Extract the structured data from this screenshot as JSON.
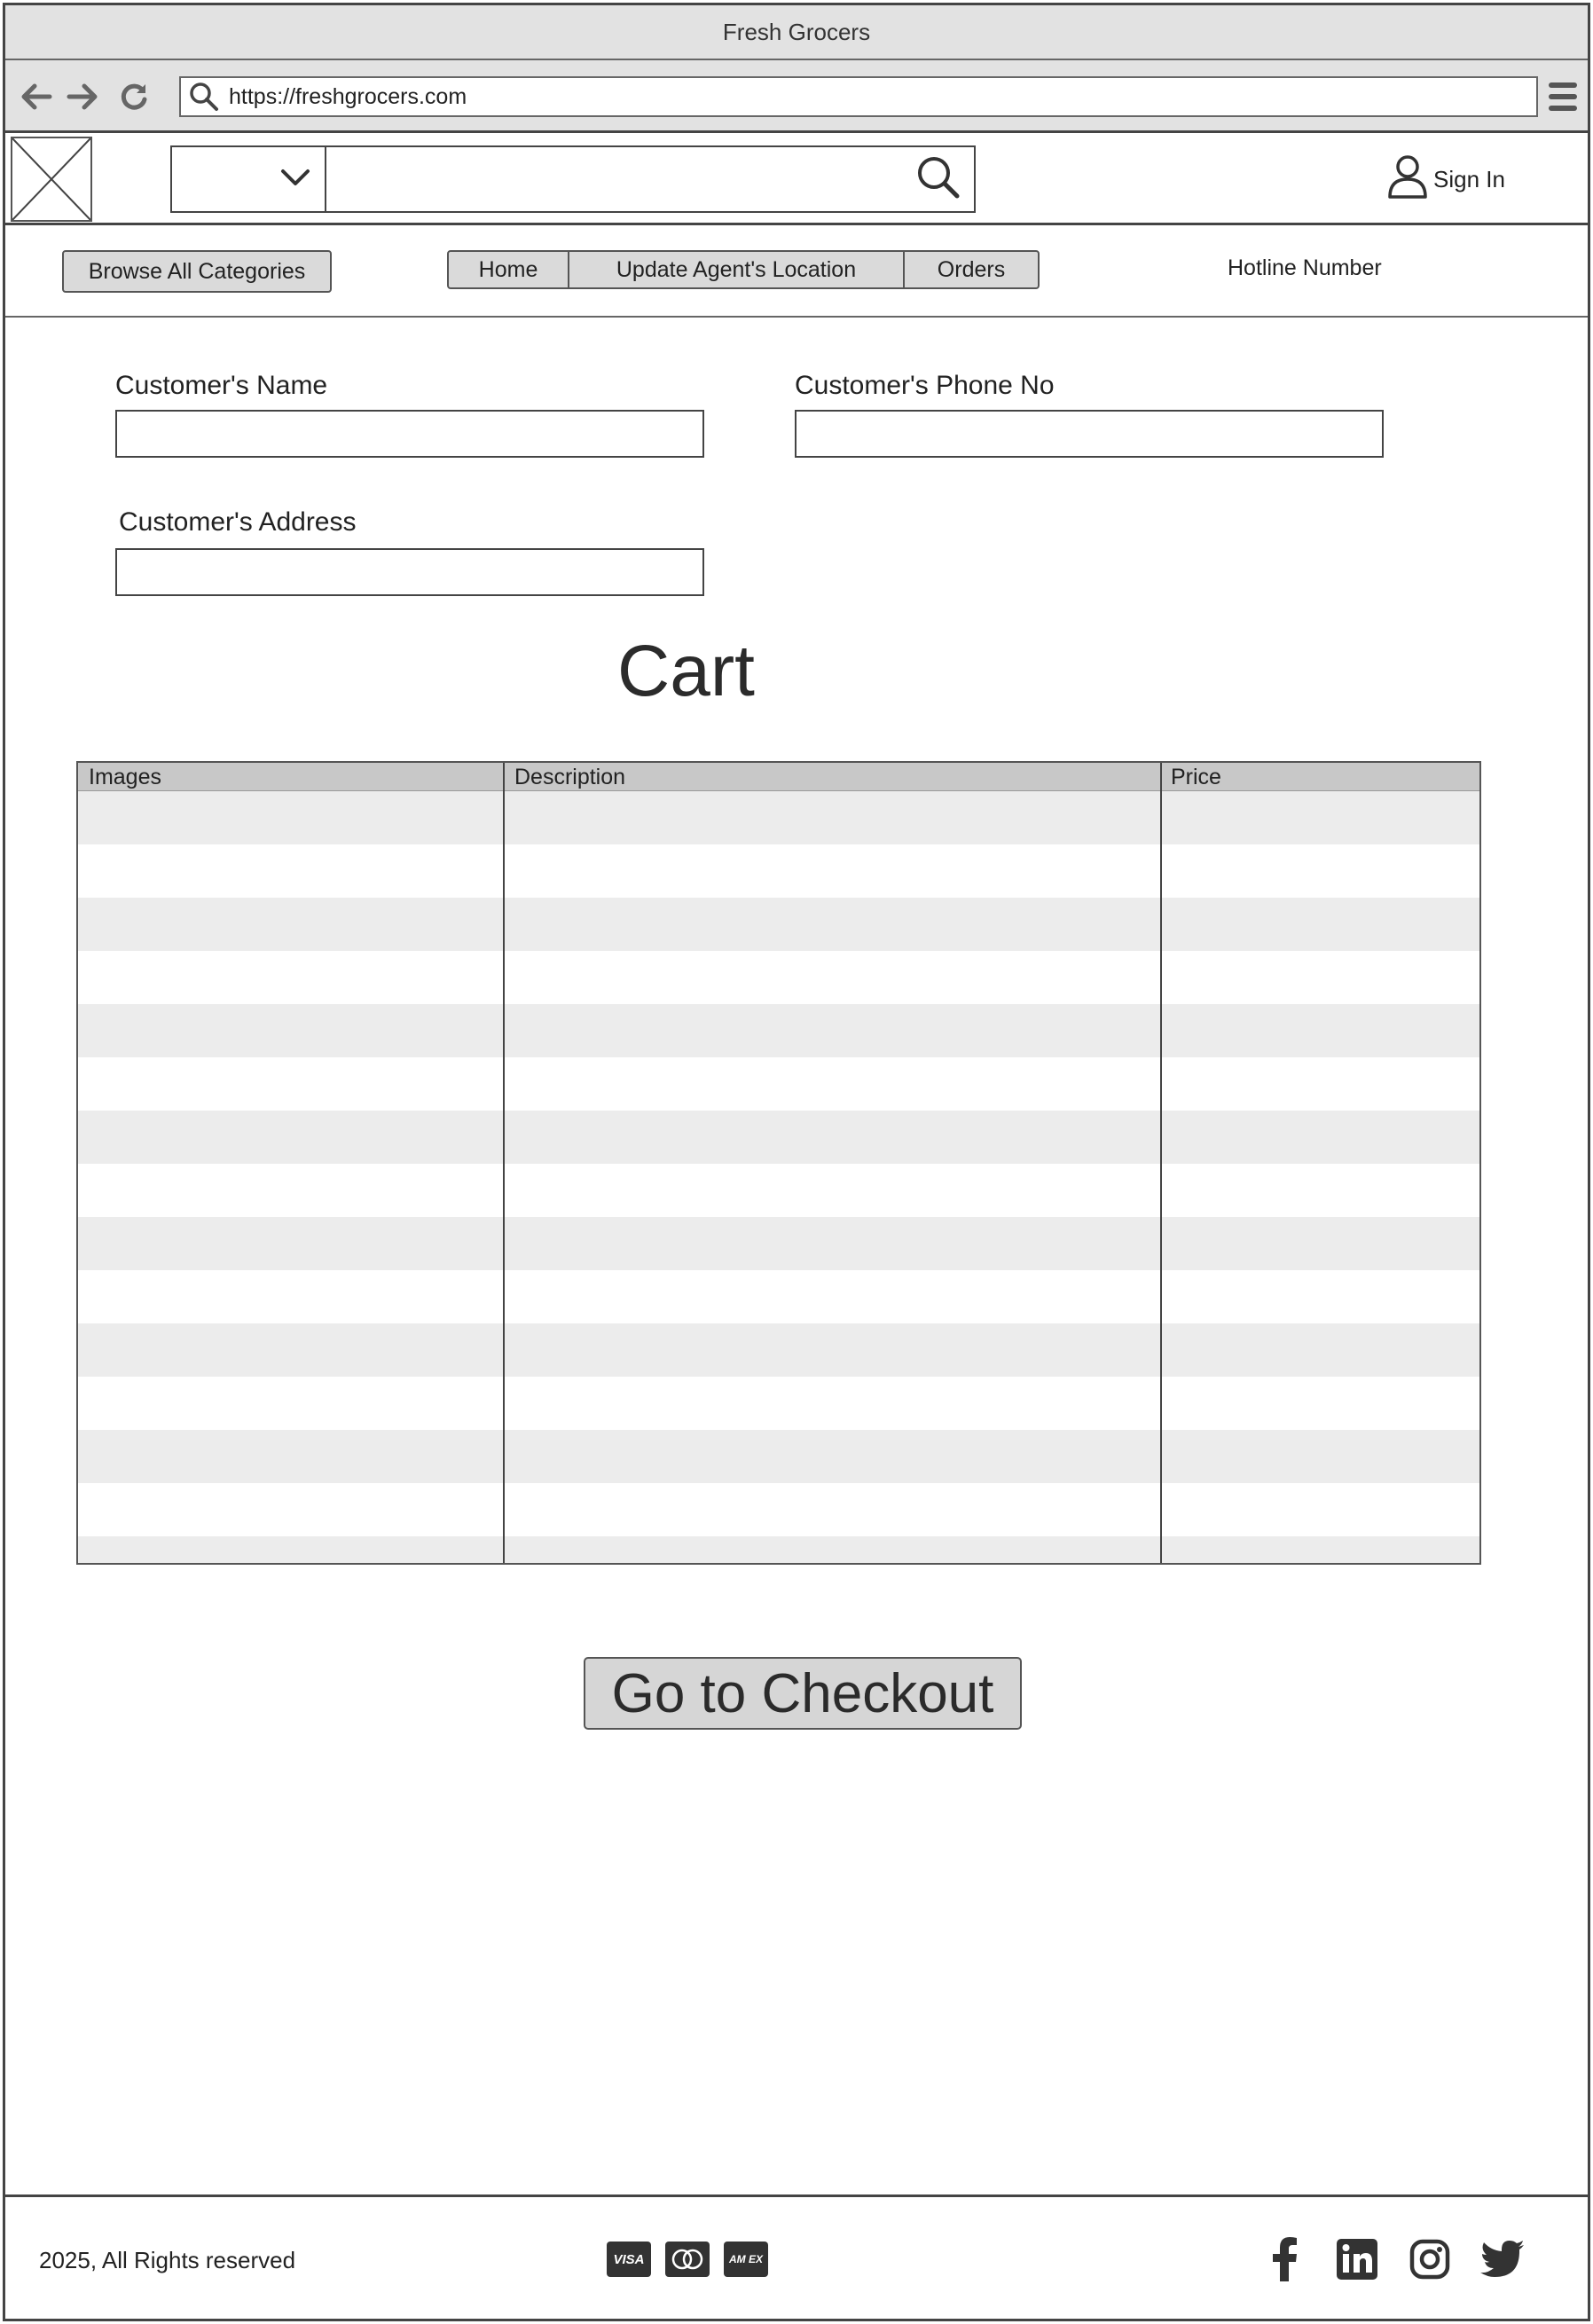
{
  "window": {
    "title": "Fresh Grocers"
  },
  "browser": {
    "url": "https://freshgrocers.com"
  },
  "header": {
    "search_category": "",
    "search_value": "",
    "signin_label": "Sign In"
  },
  "navbar": {
    "browse_label": "Browse All Categories",
    "tabs": [
      {
        "label": "Home"
      },
      {
        "label": "Update Agent's Location"
      },
      {
        "label": "Orders"
      }
    ],
    "hotline_label": "Hotline Number"
  },
  "form": {
    "name_label": "Customer's Name",
    "name_value": "",
    "phone_label": "Customer's Phone No",
    "phone_value": "",
    "address_label": "Customer's Address",
    "address_value": ""
  },
  "cart": {
    "title": "Cart",
    "columns": [
      "Images",
      "Description",
      "Price"
    ],
    "rows": []
  },
  "checkout": {
    "label": "Go to Checkout"
  },
  "footer": {
    "copyright": "2025, All Rights reserved",
    "payments": [
      {
        "icon": "visa-icon",
        "label": "VISA"
      },
      {
        "icon": "mastercard-icon",
        "label": ""
      },
      {
        "icon": "amex-icon",
        "label": "AM EX"
      }
    ],
    "socials": [
      "facebook-icon",
      "linkedin-icon",
      "instagram-icon",
      "twitter-icon"
    ]
  },
  "colors": {
    "chrome_bg": "#e2e2e2",
    "button_bg": "#dadada",
    "table_header_bg": "#c8c8c8",
    "table_stripe": "#ececec",
    "stroke": "#444444"
  }
}
